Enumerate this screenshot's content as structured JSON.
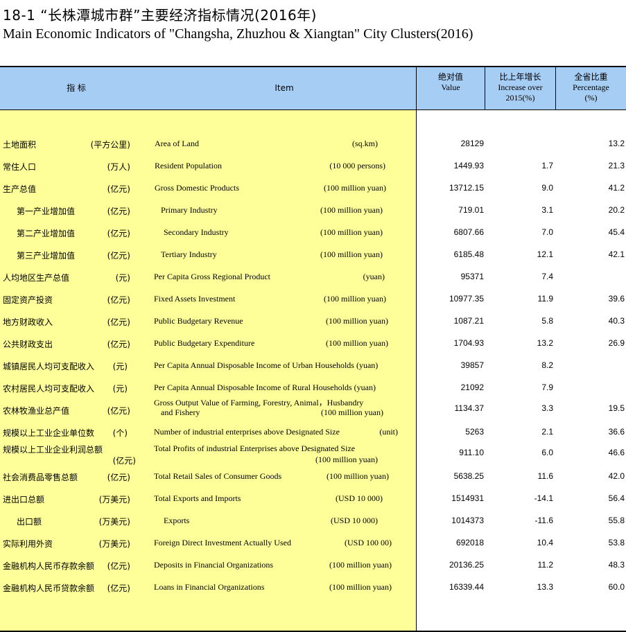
{
  "title": {
    "cn": "18-1 “长株潭城市群”主要经济指标情况(2016年)",
    "en": "Main Economic Indicators of \"Changsha, Zhuzhou & Xiangtan\" City Clusters(2016)"
  },
  "headers": {
    "indicator_cn": "指 标",
    "item_en": "Item",
    "value_cn": "绝对值",
    "value_en": "Value",
    "increase_cn": "比上年增长",
    "increase_en1": "Increase over",
    "increase_en2": "2015(%)",
    "pct_cn": "全省比重",
    "pct_en1": "Percentage",
    "pct_en2": "(%)"
  },
  "rows": [
    {
      "cn": "土地面积",
      "cn_unit": "(平方公里)",
      "en": "Area of Land",
      "en2": "",
      "en_unit": "(sq.km)",
      "value": "28129",
      "increase": "",
      "pct": "13.2"
    },
    {
      "cn": "常住人口",
      "cn_unit": "(万人)",
      "en": "Resident Population",
      "en2": "",
      "en_unit": "(10 000 persons)",
      "value": "1449.93",
      "increase": "1.7",
      "pct": "21.3"
    },
    {
      "cn": "生产总值",
      "cn_unit": "(亿元)",
      "en": "Gross Domestic Products",
      "en2": "",
      "en_unit": "(100 million yuan)",
      "value": "13712.15",
      "increase": "9.0",
      "pct": "41.2"
    },
    {
      "cn": "第一产业增加值",
      "cn_unit": "(亿元)",
      "en": "Primary Industry",
      "en2": "",
      "en_unit": "(100 million yuan)",
      "value": "719.01",
      "increase": "3.1",
      "pct": "20.2"
    },
    {
      "cn": "第二产业增加值",
      "cn_unit": "(亿元)",
      "en": "Secondary Industry",
      "en2": "",
      "en_unit": "(100 million yuan)",
      "value": "6807.66",
      "increase": "7.0",
      "pct": "45.4"
    },
    {
      "cn": "第三产业增加值",
      "cn_unit": "(亿元)",
      "en": "Tertiary Industry",
      "en2": "",
      "en_unit": "(100 million yuan)",
      "value": "6185.48",
      "increase": "12.1",
      "pct": "42.1"
    },
    {
      "cn": "人均地区生产总值",
      "cn_unit": "(元)",
      "en": "Per  Capita Gross Regional Product",
      "en2": "",
      "en_unit": "(yuan)",
      "value": "95371",
      "increase": "7.4",
      "pct": ""
    },
    {
      "cn": "固定资产投资",
      "cn_unit": "(亿元)",
      "en": "Fixed Assets Investment",
      "en2": "",
      "en_unit": "(100 million yuan)",
      "value": "10977.35",
      "increase": "11.9",
      "pct": "39.6"
    },
    {
      "cn": "地方财政收入",
      "cn_unit": "(亿元)",
      "en": "Public Budgetary Revenue",
      "en2": "",
      "en_unit": "(100 million yuan)",
      "value": "1087.21",
      "increase": "5.8",
      "pct": "40.3"
    },
    {
      "cn": "公共财政支出",
      "cn_unit": "(亿元)",
      "en": "Public Budgetary Expenditure",
      "en2": "",
      "en_unit": "(100 million yuan)",
      "value": "1704.93",
      "increase": "13.2",
      "pct": "26.9"
    },
    {
      "cn": "城镇居民人均可支配收入",
      "cn_unit": "(元)",
      "en": "Per Capita Annual Disposable Income of Urban Households (yuan)",
      "en2": "",
      "en_unit": "",
      "value": "39857",
      "increase": "8.2",
      "pct": ""
    },
    {
      "cn": "农村居民人均可支配收入",
      "cn_unit": "(元)",
      "en": "Per Capita Annual Disposable Income of Rural Households  (yuan)",
      "en2": "",
      "en_unit": "",
      "value": "21092",
      "increase": "7.9",
      "pct": ""
    },
    {
      "cn": "农林牧渔业总产值",
      "cn_unit": "(亿元)",
      "en": "Gross Output Value of Farming, Forestry, Animal，Husbandry",
      "en2": "and Fishery",
      "en_unit": "(100 million yuan)",
      "value": "1134.37",
      "increase": "3.3",
      "pct": "19.5"
    },
    {
      "cn": "规模以上工业企业单位数",
      "cn_unit": "(个)",
      "en": "Number of industrial enterprises above Designated Size",
      "en2": "",
      "en_unit": "(unit)",
      "value": "5263",
      "increase": "2.1",
      "pct": "36.6"
    },
    {
      "cn": "规模以上工业企业利润总额",
      "cn_unit": "(亿元)",
      "en": "Total Profits of industrial Enterprises  above Designated Size",
      "en2": "",
      "en_unit": "(100 million yuan)",
      "value": "911.10",
      "increase": "6.0",
      "pct": "46.6"
    },
    {
      "cn": "社会消费品零售总额",
      "cn_unit": "(亿元)",
      "en": "Total Retail Sales of Consumer Goods",
      "en2": "",
      "en_unit": "(100 million yuan)",
      "value": "5638.25",
      "increase": "11.6",
      "pct": "42.0"
    },
    {
      "cn": "进出口总额",
      "cn_unit": "(万美元)",
      "en": "Total Exports and Imports",
      "en2": "",
      "en_unit": "(USD 10 000)",
      "value": "1514931",
      "increase": "-14.1",
      "pct": "56.4"
    },
    {
      "cn": "出口额",
      "cn_unit": "(万美元)",
      "en": "Exports",
      "en2": "",
      "en_unit": "(USD 10 000)",
      "value": "1014373",
      "increase": "-11.6",
      "pct": "55.8"
    },
    {
      "cn": "实际利用外资",
      "cn_unit": "(万美元)",
      "en": "Foreign Direct Investment Actually Used",
      "en2": "",
      "en_unit": "(USD 100 00)",
      "value": "692018",
      "increase": "10.4",
      "pct": "53.8"
    },
    {
      "cn": "金融机构人民币存款余额",
      "cn_unit": "(亿元)",
      "en": "Deposits in Financial Organizations",
      "en2": "",
      "en_unit": "(100 million yuan)",
      "value": "20136.25",
      "increase": "11.2",
      "pct": "48.3"
    },
    {
      "cn": "金融机构人民币贷款余额",
      "cn_unit": "(亿元)",
      "en": "Loans in Financial Organizations",
      "en2": "",
      "en_unit": "(100 million yuan)",
      "value": "16339.44",
      "increase": "13.3",
      "pct": "60.0"
    }
  ]
}
